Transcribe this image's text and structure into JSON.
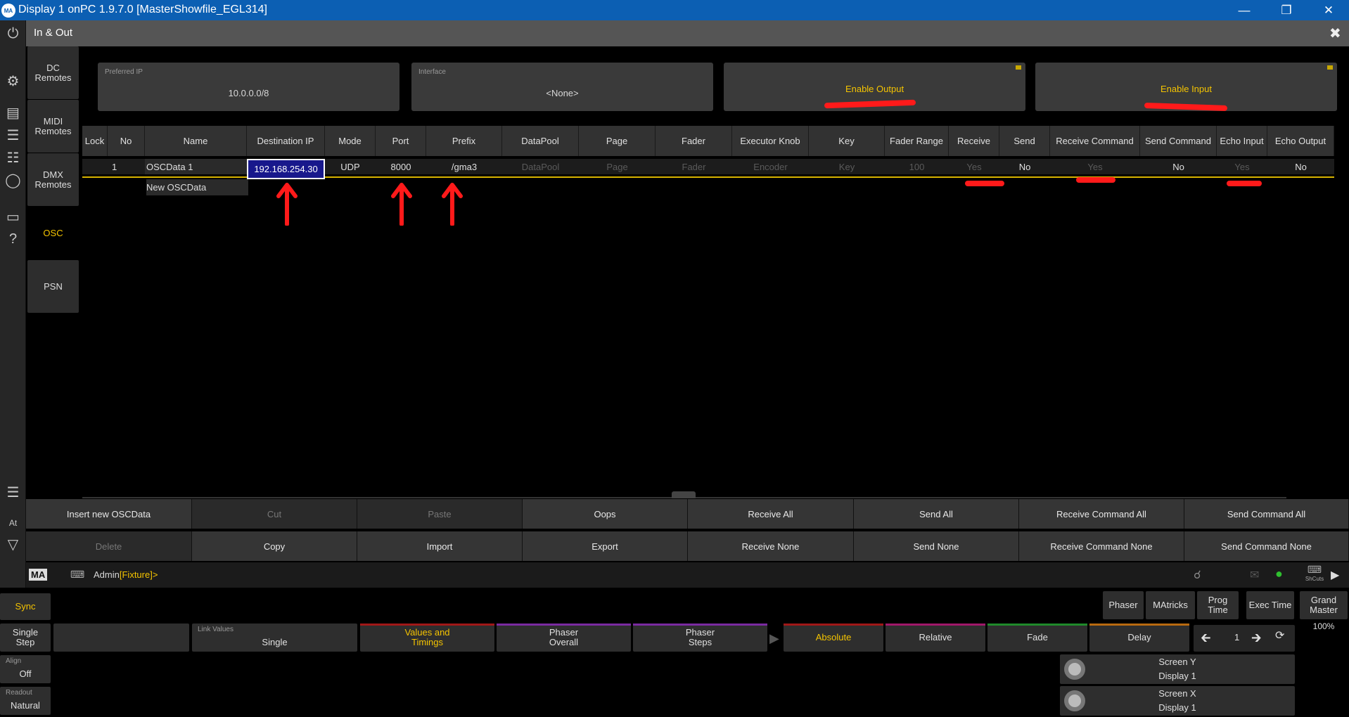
{
  "window": {
    "title": "Display 1 onPC 1.9.7.0 [MasterShowfile_EGL314]",
    "logo": "MA",
    "controls": [
      "minimize",
      "restore",
      "close"
    ]
  },
  "header": {
    "title": "In & Out",
    "close_icon": "close-icon"
  },
  "subnav": [
    {
      "label": "DC\nRemotes",
      "active": false
    },
    {
      "label": "MIDI\nRemotes",
      "active": false
    },
    {
      "label": "DMX\nRemotes",
      "active": false
    },
    {
      "label": "OSC",
      "active": true
    },
    {
      "label": "PSN",
      "active": false
    }
  ],
  "props": {
    "preferred_ip": {
      "label": "Preferred IP",
      "value": "10.0.0.0/8"
    },
    "interface": {
      "label": "Interface",
      "value": "<None>"
    },
    "enable_output": {
      "label": "Enable Output"
    },
    "enable_input": {
      "label": "Enable Input"
    }
  },
  "table": {
    "columns": [
      "Lock",
      "No",
      "Name",
      "Destination IP",
      "Mode",
      "Port",
      "Prefix",
      "DataPool",
      "Page",
      "Fader",
      "Executor Knob",
      "Key",
      "Fader Range",
      "Receive",
      "Send",
      "Receive Command",
      "Send Command",
      "Echo Input",
      "Echo Output"
    ],
    "rows": [
      {
        "lock": "",
        "no": "1",
        "name": "OSCData 1",
        "destination_ip": "192.168.254.30",
        "mode": "UDP",
        "port": "8000",
        "prefix": "/gma3",
        "datapool": "DataPool",
        "page": "Page",
        "fader": "Fader",
        "executor_knob": "Encoder",
        "key": "Key",
        "fader_range": "100",
        "receive": "Yes",
        "send": "No",
        "receive_command": "Yes",
        "send_command": "No",
        "echo_input": "Yes",
        "echo_output": "No"
      }
    ],
    "new_row": "New OSCData"
  },
  "buttons": {
    "row1": [
      "Insert new OSCData",
      "Cut",
      "Paste",
      "Oops",
      "Receive All",
      "Send All",
      "Receive Command All",
      "Send Command All"
    ],
    "row2": [
      "Delete",
      "Copy",
      "Import",
      "Export",
      "Receive None",
      "Send None",
      "Receive Command None",
      "Send Command None"
    ]
  },
  "cmdline": {
    "prefix": "Admin",
    "bracket_text": "Fixture",
    "open": "[",
    "close": "]>",
    "logo": "MA",
    "shortcuts": "ShCuts"
  },
  "bottom": {
    "sync": "Sync",
    "single_step": "Single\nStep",
    "align_label": "Align",
    "align_value": "Off",
    "readout_label": "Readout",
    "readout_value": "Natural",
    "link_values_label": "Link Values",
    "link_values_value": "Single",
    "values_timings": "Values and\nTimings",
    "phaser_overall": "Phaser\nOverall",
    "phaser_steps": "Phaser\nSteps",
    "absolute": "Absolute",
    "relative": "Relative",
    "fade": "Fade",
    "delay": "Delay",
    "phaser": "Phaser",
    "matricks": "MAtricks",
    "prog_time": "Prog Time",
    "exec_time": "Exec Time",
    "grand_master": "Grand\nMaster",
    "grand_master_value": "100%",
    "page_number": "1",
    "screen_y_label": "Screen Y",
    "screen_y_value": "Display 1",
    "screen_x_label": "Screen X",
    "screen_x_value": "Display 1"
  },
  "colors": {
    "accent": "#f5c400",
    "titlebar": "#0c5fb3",
    "annotation": "#ff1a1a",
    "selection": "#18188c"
  }
}
